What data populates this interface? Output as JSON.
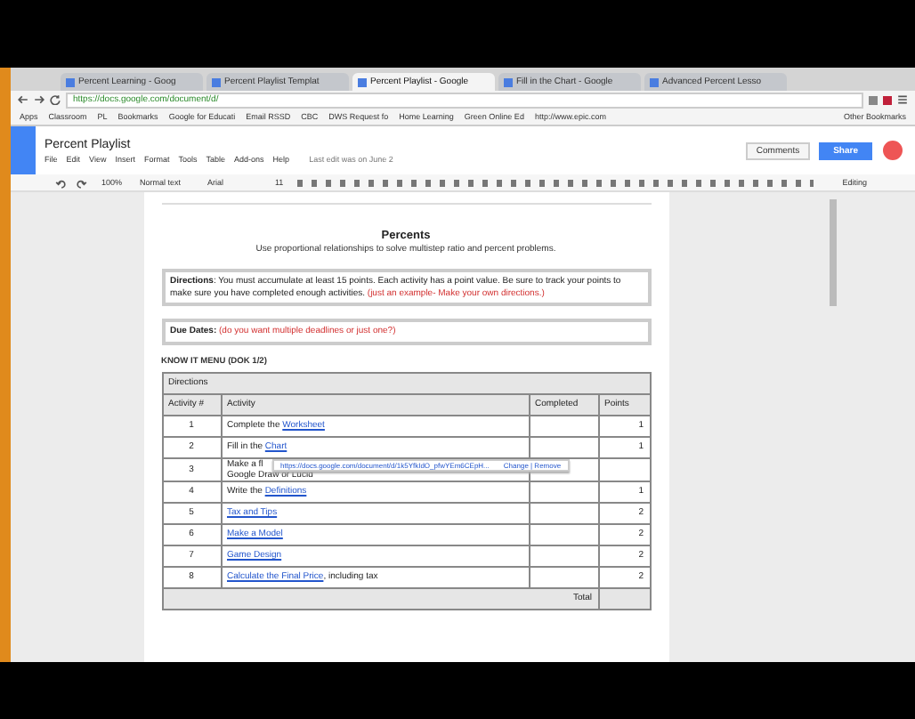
{
  "browser": {
    "tabs": [
      {
        "label": "Percent Learning - Goog",
        "selected": false
      },
      {
        "label": "Percent Playlist Templat",
        "selected": false
      },
      {
        "label": "Percent Playlist - Google",
        "selected": true
      },
      {
        "label": "Fill in the Chart - Google",
        "selected": false
      },
      {
        "label": "Advanced Percent Lesso",
        "selected": false
      }
    ],
    "url": "https://docs.google.com/document/d/",
    "bookmarks": [
      "Apps",
      "Classroom",
      "PL",
      "Bookmarks",
      "Google for Educati",
      "Email RSSD",
      "CBC",
      "DWS Request fo",
      "Home Learning",
      "Green Online Ed",
      "http://www.epic.com"
    ],
    "other_bookmarks": "Other Bookmarks"
  },
  "doc": {
    "title": "Percent Playlist",
    "menu": [
      "File",
      "Edit",
      "View",
      "Insert",
      "Format",
      "Tools",
      "Table",
      "Add-ons",
      "Help"
    ],
    "last_edit": "Last edit was on June 2",
    "comments_button": "Comments",
    "share_button": "Share",
    "toolbar": {
      "zoom": "100%",
      "style": "Normal text",
      "font": "Arial",
      "size": "11",
      "mode": "Editing"
    }
  },
  "page": {
    "heading": "Percents",
    "subtitle": "Use proportional relationships to solve multistep ratio and percent problems.",
    "directions": {
      "label": "Directions",
      "text": ": You must accumulate at least 15 points.  Each activity has a point value.  Be sure to track your points to make sure you have completed enough activities.",
      "note": "(just an example- Make your own directions.)"
    },
    "due": {
      "label": "Due Dates:",
      "note": "(do you want multiple deadlines or just one?)"
    },
    "menu_title": "KNOW IT MENU (DOK 1/2)",
    "table": {
      "banner": "Directions",
      "columns": [
        "Activity #",
        "Activity",
        "Completed",
        "Points"
      ],
      "rows": [
        {
          "num": "1",
          "parts": [
            {
              "text": "Complete the ",
              "link": false
            },
            {
              "text": "Worksheet",
              "link": true
            }
          ],
          "points": "1"
        },
        {
          "num": "2",
          "parts": [
            {
              "text": "Fill in the ",
              "link": false
            },
            {
              "text": "Chart",
              "link": true
            }
          ],
          "points": "1"
        },
        {
          "num": "3",
          "parts": [
            {
              "text": "Make a fl",
              "link": false
            }
          ],
          "extra": "Google Draw or Lucid",
          "points": ""
        },
        {
          "num": "4",
          "parts": [
            {
              "text": "Write the ",
              "link": false
            },
            {
              "text": "Definitions",
              "link": true
            }
          ],
          "points": "1"
        },
        {
          "num": "5",
          "parts": [
            {
              "text": "Tax and Tips",
              "link": true
            }
          ],
          "points": "2"
        },
        {
          "num": "6",
          "parts": [
            {
              "text": "Make a Model",
              "link": true
            }
          ],
          "points": "2"
        },
        {
          "num": "7",
          "parts": [
            {
              "text": "Game Design",
              "link": true
            }
          ],
          "points": "2"
        },
        {
          "num": "8",
          "parts": [
            {
              "text": "Calculate the Final Price",
              "link": true
            },
            {
              "text": ", including tax",
              "link": false
            }
          ],
          "points": "2"
        }
      ],
      "total_label": "Total"
    },
    "link_popup": {
      "url": "https://docs.google.com/document/d/1k5YfkIdO_pfwYEm6CEpH...",
      "actions": "Change | Remove"
    }
  }
}
